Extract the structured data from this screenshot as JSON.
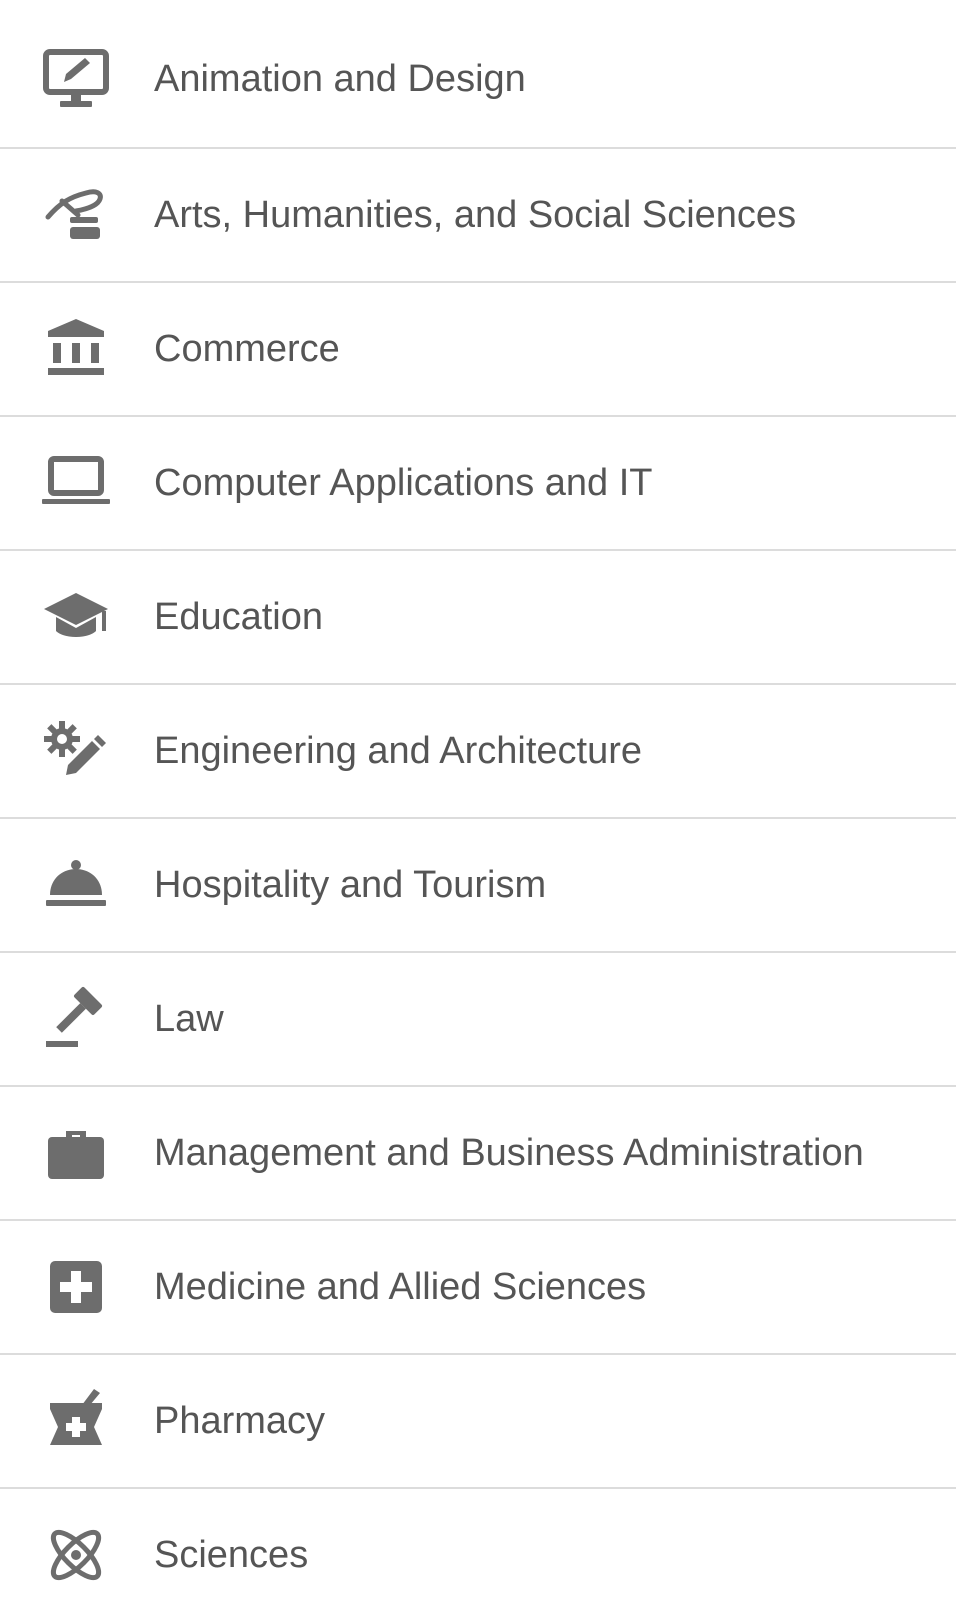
{
  "colors": {
    "icon": "#6d6d6d",
    "text": "#555555",
    "divider": "#dcdcdc"
  },
  "categories": [
    {
      "label": "Animation and Design",
      "icon": "monitor-edit-icon"
    },
    {
      "label": "Arts, Humanities, and Social Sciences",
      "icon": "quill-icon"
    },
    {
      "label": "Commerce",
      "icon": "bank-icon"
    },
    {
      "label": "Computer Applications and IT",
      "icon": "laptop-icon"
    },
    {
      "label": "Education",
      "icon": "graduation-cap-icon"
    },
    {
      "label": "Engineering and Architecture",
      "icon": "gear-pencil-icon"
    },
    {
      "label": "Hospitality and Tourism",
      "icon": "service-bell-icon"
    },
    {
      "label": "Law",
      "icon": "gavel-icon"
    },
    {
      "label": "Management and Business Administration",
      "icon": "briefcase-icon"
    },
    {
      "label": "Medicine and Allied Sciences",
      "icon": "medical-cross-icon"
    },
    {
      "label": "Pharmacy",
      "icon": "mortar-pestle-icon"
    },
    {
      "label": "Sciences",
      "icon": "atom-icon"
    }
  ]
}
